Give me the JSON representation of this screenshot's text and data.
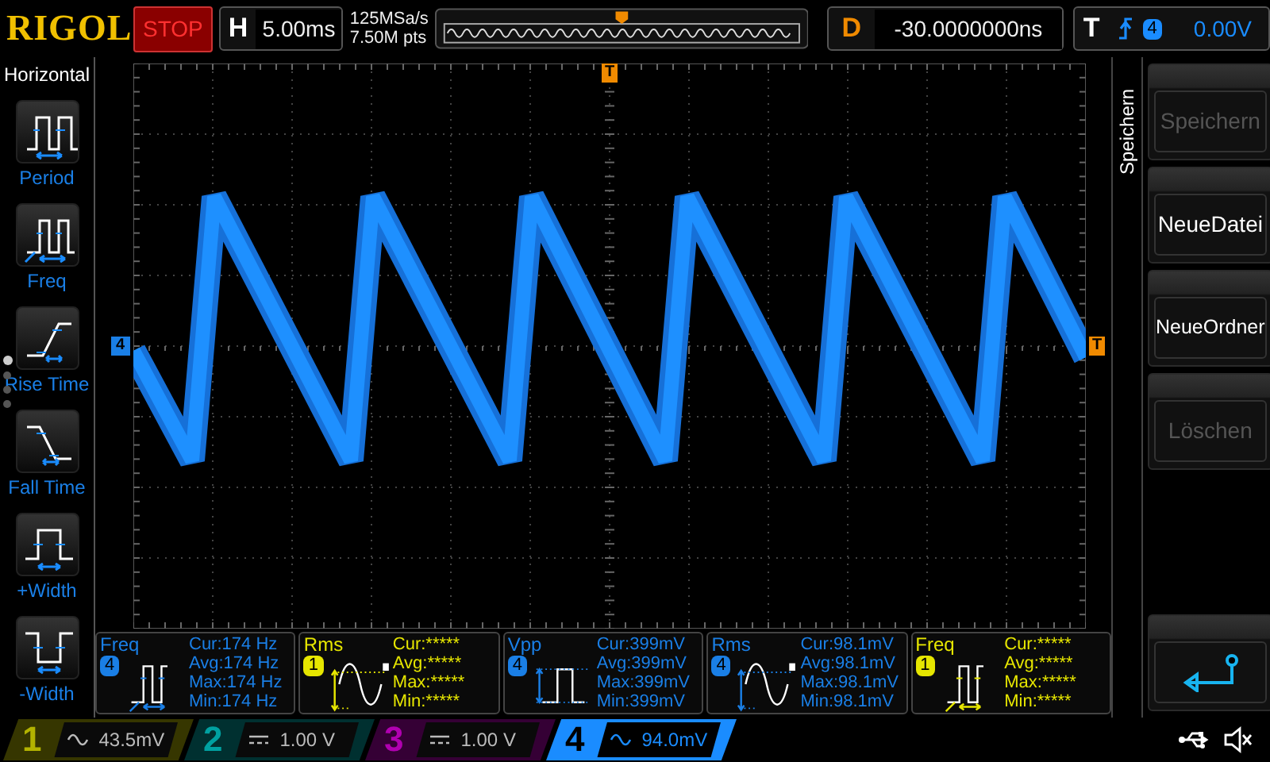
{
  "header": {
    "logo": "RIGOL",
    "run_state": "STOP",
    "timebase": {
      "label": "H",
      "value": "5.00ms"
    },
    "sample_rate": "125MSa/s",
    "memory_depth": "7.50M pts",
    "delay": {
      "label": "D",
      "value": "-30.0000000ns"
    },
    "trigger": {
      "label": "T",
      "channel": "4",
      "level": "0.00V"
    }
  },
  "sidebar": {
    "title": "Horizontal",
    "items": [
      {
        "label": "Period",
        "kind": "period"
      },
      {
        "label": "Freq",
        "kind": "freq"
      },
      {
        "label": "Rise Time",
        "kind": "rise"
      },
      {
        "label": "Fall Time",
        "kind": "fall"
      },
      {
        "label": "+Width",
        "kind": "pwidth"
      },
      {
        "label": "-Width",
        "kind": "nwidth"
      }
    ],
    "pages": [
      {
        "selected": true
      },
      {
        "selected": false
      },
      {
        "selected": false
      },
      {
        "selected": false
      }
    ]
  },
  "scope": {
    "trigger_position_marker": "T",
    "channel_marker": "4",
    "trigger_level_marker": "T"
  },
  "measurements": [
    {
      "name": "Freq",
      "channel": "4",
      "color": "#1a7fe6",
      "kind": "freq",
      "cur": "Cur:174 Hz",
      "avg": "Avg:174 Hz",
      "max": "Max:174 Hz",
      "min": "Min:174 Hz"
    },
    {
      "name": "Rms",
      "channel": "1",
      "color": "#e6e600",
      "kind": "rms",
      "cur": "Cur:*****",
      "avg": "Avg:*****",
      "max": "Max:*****",
      "min": "Min:*****"
    },
    {
      "name": "Vpp",
      "channel": "4",
      "color": "#1a7fe6",
      "kind": "vpp",
      "cur": "Cur:399mV",
      "avg": "Avg:399mV",
      "max": "Max:399mV",
      "min": "Min:399mV"
    },
    {
      "name": "Rms",
      "channel": "4",
      "color": "#1a7fe6",
      "kind": "rms",
      "cur": "Cur:98.1mV",
      "avg": "Avg:98.1mV",
      "max": "Max:98.1mV",
      "min": "Min:98.1mV"
    },
    {
      "name": "Freq",
      "channel": "1",
      "color": "#e6e600",
      "kind": "freq",
      "cur": "Cur:*****",
      "avg": "Avg:*****",
      "max": "Max:*****",
      "min": "Min:*****"
    }
  ],
  "menu": {
    "title": "Speichern",
    "buttons": [
      {
        "label": "Speichern",
        "disabled": true,
        "kind": "text"
      },
      {
        "label": "NeueDatei",
        "disabled": false,
        "kind": "text"
      },
      {
        "label": "NeueOrdner",
        "disabled": false,
        "kind": "text"
      },
      {
        "label": "Löschen",
        "disabled": true,
        "kind": "text"
      },
      {
        "kind": "spacer"
      },
      {
        "kind": "back",
        "disabled": false
      }
    ]
  },
  "channels": [
    {
      "number": "1",
      "kind": "ac",
      "value": "43.5mV",
      "color": "#b3b300",
      "selected": false
    },
    {
      "number": "2",
      "kind": "dc",
      "value": "1.00 V",
      "color": "#00a0a0",
      "selected": false
    },
    {
      "number": "3",
      "kind": "dc",
      "value": "1.00 V",
      "color": "#b000b0",
      "selected": false
    },
    {
      "number": "4",
      "kind": "ac",
      "value": "94.0mV",
      "color": "#1a8cff",
      "selected": true
    }
  ]
}
